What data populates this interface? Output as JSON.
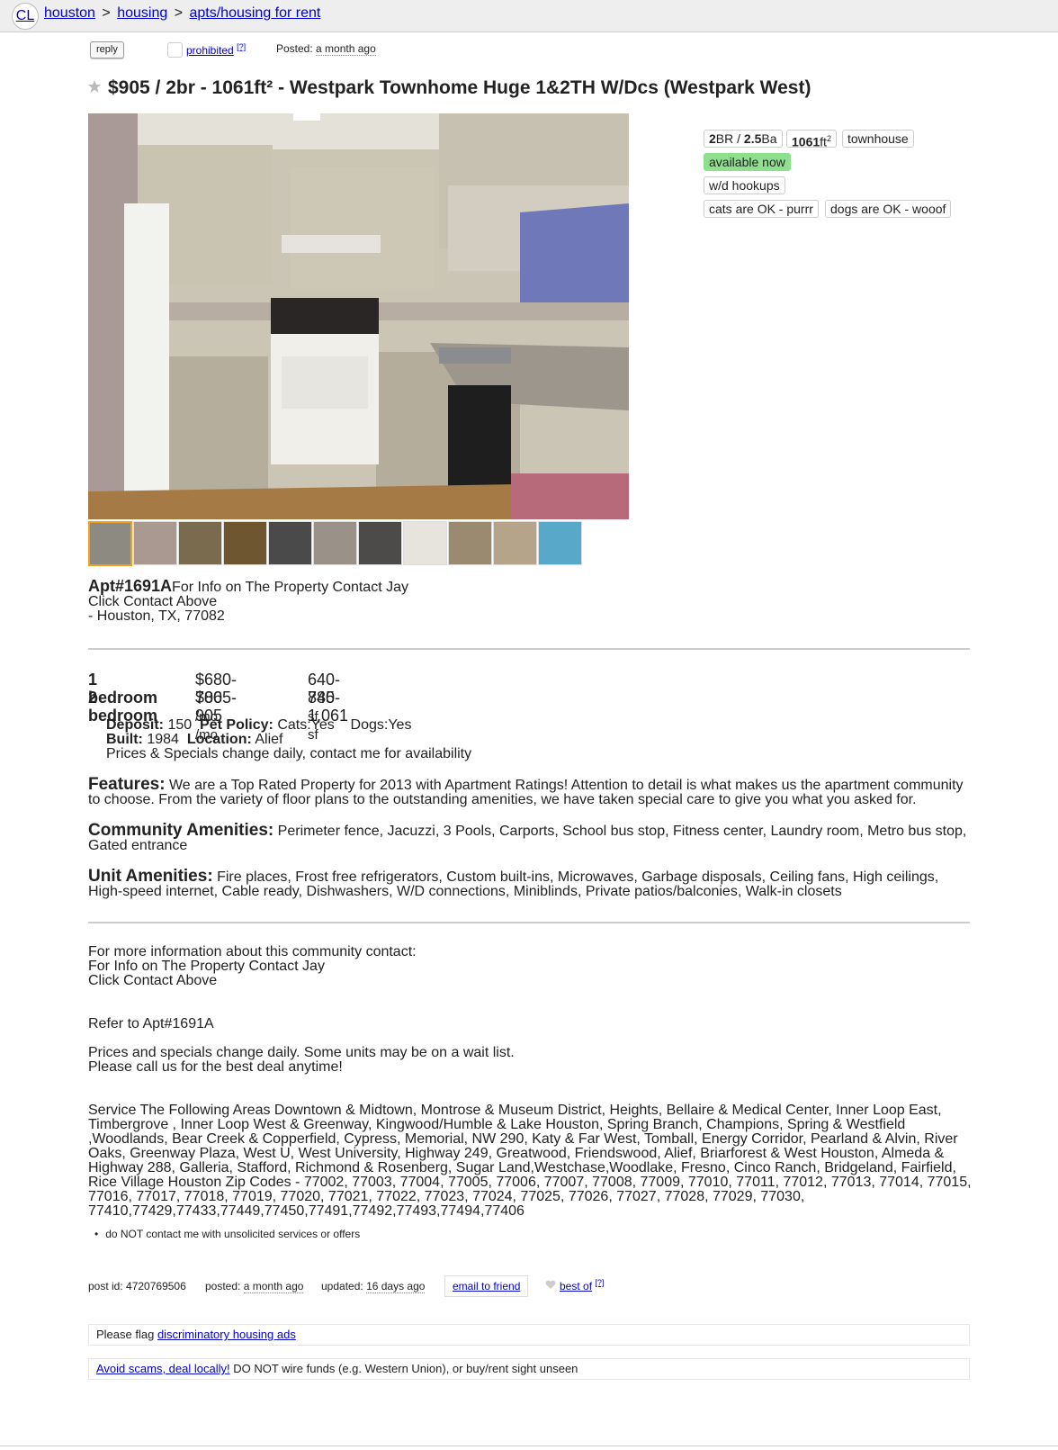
{
  "header": {
    "logo": "CL",
    "breadcrumbs": [
      "houston",
      "housing",
      "apts/housing for rent"
    ],
    "separator": ">"
  },
  "actions": {
    "reply_label": "reply",
    "prohibited_label": "prohibited",
    "help_mark": "[?]",
    "posted_label": "Posted:",
    "posted_value": "a month ago"
  },
  "listing": {
    "title": "$905 / 2br - 1061ft² - Westpark Townhome Huge 1&2TH W/Dcs (Westpark West)"
  },
  "attributes": {
    "br_num": "2",
    "br_text": "BR / ",
    "ba_num": "2.5",
    "ba_text": "Ba",
    "sqft_num": "1061",
    "sqft_unit": "ft",
    "sqft_sup": "2",
    "type": "townhouse",
    "availability": "available now",
    "laundry": "w/d hookups",
    "cats": "cats are OK - purrr",
    "dogs": "dogs are OK - wooof"
  },
  "gallery": {
    "thumbnail_count": 11,
    "selected_index": 0
  },
  "address": {
    "apt": "Apt#1691A",
    "line1": "For Info on The Property Contact Jay",
    "line2": "Click Contact Above",
    "line3": "- Houston, TX, 77082"
  },
  "units": [
    {
      "bedrooms": "1 bedroom",
      "price": "$680-700",
      "per": "/mo",
      "size": "640-740",
      "unit": "sf"
    },
    {
      "bedrooms": "2 bedroom",
      "price": "$865-905",
      "per": "/mo",
      "size": "885-1,061",
      "unit": "sf"
    }
  ],
  "details": {
    "deposit_label": "Deposit:",
    "deposit_value": "150",
    "pet_label": "Pet Policy:",
    "pet_value": "Cats:Yes    Dogs:Yes",
    "built_label": "Built:",
    "built_value": "1984",
    "location_label": "Location:",
    "location_value": "Alief",
    "note": "Prices & Specials change daily, contact me for availability"
  },
  "features": {
    "label": "Features:",
    "text": "We are a Top Rated Property for 2013 with Apartment Ratings! Attention to detail is what makes us the apartment community to choose. From the variety of floor plans to the outstanding amenities, we have taken special care to give you what you asked for."
  },
  "community": {
    "label": "Community Amenities:",
    "text": "Perimeter fence, Jacuzzi, 3 Pools, Carports, School bus stop, Fitness center, Laundry room, Metro bus stop, Gated entrance"
  },
  "unit_amenities": {
    "label": "Unit Amenities:",
    "text": "Fire places, Frost free refrigerators, Custom built-ins, Microwaves, Garbage disposals, Ceiling fans, High ceilings, High-speed internet, Cable ready, Dishwashers, W/D connections, Miniblinds, Private patios/balconies, Walk-in closets"
  },
  "contact": {
    "line1": "For more information about this community contact:",
    "line2": "For Info on The Property Contact Jay",
    "line3": "Click Contact Above",
    "refer": "Refer to Apt#1691A",
    "prices1": "Prices and specials change daily. Some units may be on a wait list.",
    "prices2": "Please call us for the best deal anytime!"
  },
  "service_areas": "Service The Following Areas Downtown & Midtown, Montrose & Museum District, Heights, Bellaire & Medical Center, Inner Loop East, Timbergrove , Inner Loop West & Greenway, Kingwood/Humble & Lake Houston, Spring Branch, Champions, Spring & Westfield ,Woodlands, Bear Creek & Copperfield, Cypress, Memorial, NW 290, Katy & Far West, Tomball, Energy Corridor, Pearland & Alvin, River Oaks, Greenway Plaza, West U, West University, Highway 249, Greatwood, Friendswood, Alief, Briarforest & West Houston, Almeda & Highway 288, Galleria, Stafford, Richmond & Rosenberg, Sugar Land,Westchase,Woodlake, Fresno, Cinco Ranch, Bridgeland, Fairfield, Rice Village Houston Zip Codes - 77002, 77003, 77004, 77005, 77006, 77007, 77008, 77009, 77010, 77011, 77012, 77013, 77014, 77015, 77016, 77017, 77018, 77019, 77020, 77021, 77022, 77023, 77024, 77025, 77026, 77027, 77028, 77029, 77030, 77410,77429,77433,77449,77450,77491,77492,77493,77494,77406",
  "notice": "do NOT contact me with unsolicited services or offers",
  "footer": {
    "post_id": "post id: 4720769506",
    "posted_label": "posted:",
    "posted_value": "a month ago",
    "updated_label": "updated:",
    "updated_value": "16 days ago",
    "email_label": "email to friend",
    "bestof_label": "best of",
    "help_mark": "[?]",
    "flag_text": "Please flag ",
    "flag_link": "discriminatory housing ads",
    "scam_link": "Avoid scams, deal locally!",
    "scam_text": " DO NOT wire funds (e.g. Western Union), or buy/rent sight unseen"
  }
}
